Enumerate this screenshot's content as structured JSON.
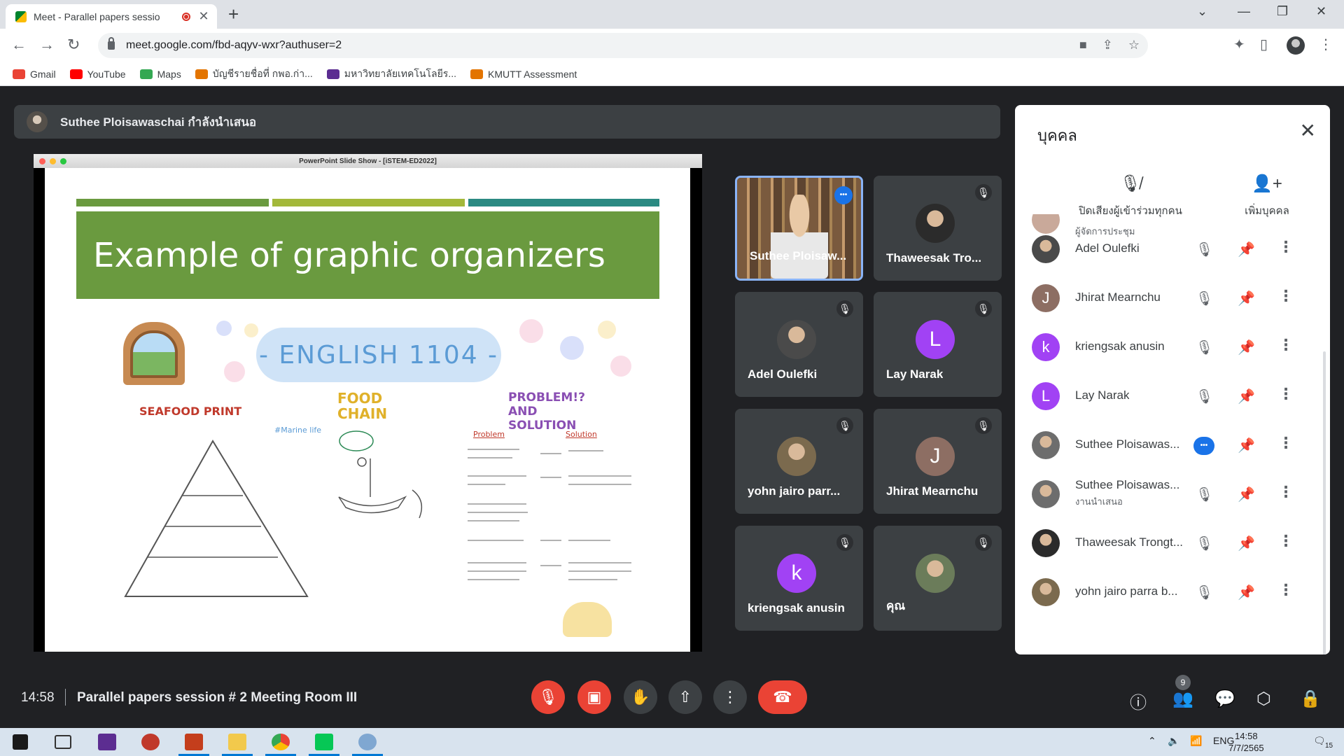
{
  "browser": {
    "tab_title": "Meet - Parallel papers sessio",
    "url": "meet.google.com/fbd-aqyv-wxr?authuser=2",
    "bookmarks": [
      {
        "label": "Gmail",
        "color": "#ea4335"
      },
      {
        "label": "YouTube",
        "color": "#ff0000"
      },
      {
        "label": "Maps",
        "color": "#34a853"
      },
      {
        "label": "บัญชีรายชื่อที่ กพอ.ก่า...",
        "color": "#e37400"
      },
      {
        "label": "มหาวิทยาลัยเทคโนโลยีร...",
        "color": "#5b2c91"
      },
      {
        "label": "KMUTT Assessment",
        "color": "#e37400"
      }
    ]
  },
  "meet": {
    "presenter_text": "Suthee Ploisawaschai กำลังนำเสนอ",
    "slide_window_title": "PowerPoint Slide Show - [iSTEM-ED2022]",
    "slide": {
      "title": "Example of graphic organizers",
      "course": "- ENGLISH 1104 -",
      "seafood": "SEAFOOD PRINT",
      "food_chain": "FOOD CHAIN",
      "problem_solution": "PROBLEM!? AND SOLUTION",
      "marine": "#Marine life",
      "problem_head": "Problem",
      "solution_head": "Solution"
    },
    "tiles": [
      {
        "name": "Suthee Ploisaw...",
        "type": "video"
      },
      {
        "name": "Thaweesak Tro...",
        "type": "photo",
        "color": "#2b2b2b"
      },
      {
        "name": "Adel Oulefki",
        "type": "photo",
        "color": "#4a4a4a"
      },
      {
        "name": "Lay Narak",
        "type": "letter",
        "letter": "L",
        "color": "#a142f4"
      },
      {
        "name": "yohn jairo parr...",
        "type": "photo",
        "color": "#7b6a4e"
      },
      {
        "name": "Jhirat Mearnchu",
        "type": "letter",
        "letter": "J",
        "color": "#8d6e63"
      },
      {
        "name": "kriengsak anusin",
        "type": "letter",
        "letter": "k",
        "color": "#a142f4"
      },
      {
        "name": "คุณ",
        "type": "photo",
        "color": "#6b7c5a"
      }
    ],
    "panel": {
      "title": "บุคคล",
      "mute_all": "ปิดเสียงผู้เข้าร่วมทุกคน",
      "add_people": "เพิ่มบุคคล",
      "partial_row_sub": "ผู้จัดการประชุม",
      "people": [
        {
          "name": "Adel Oulefki",
          "letter": "",
          "color": "#4a4a4a",
          "sub": ""
        },
        {
          "name": "Jhirat Mearnchu",
          "letter": "J",
          "color": "#8d6e63",
          "sub": ""
        },
        {
          "name": "kriengsak anusin",
          "letter": "k",
          "color": "#a142f4",
          "sub": ""
        },
        {
          "name": "Lay Narak",
          "letter": "L",
          "color": "#a142f4",
          "sub": ""
        },
        {
          "name": "Suthee Ploisawas...",
          "letter": "",
          "color": "#6d6d6d",
          "sub": ""
        },
        {
          "name": "Suthee Ploisawas...",
          "letter": "",
          "color": "#6d6d6d",
          "sub": "งานนำเสนอ"
        },
        {
          "name": "Thaweesak Trongt...",
          "letter": "",
          "color": "#2b2b2b",
          "sub": ""
        },
        {
          "name": "yohn jairo parra b...",
          "letter": "",
          "color": "#7b6a4e",
          "sub": ""
        }
      ]
    },
    "bottom": {
      "time": "14:58",
      "meeting_name": "Parallel papers session # 2 Meeting Room III",
      "people_count": "9"
    }
  },
  "taskbar": {
    "lang": "ENG",
    "time": "14:58",
    "date": "7/7/2565",
    "notifications": "15"
  }
}
